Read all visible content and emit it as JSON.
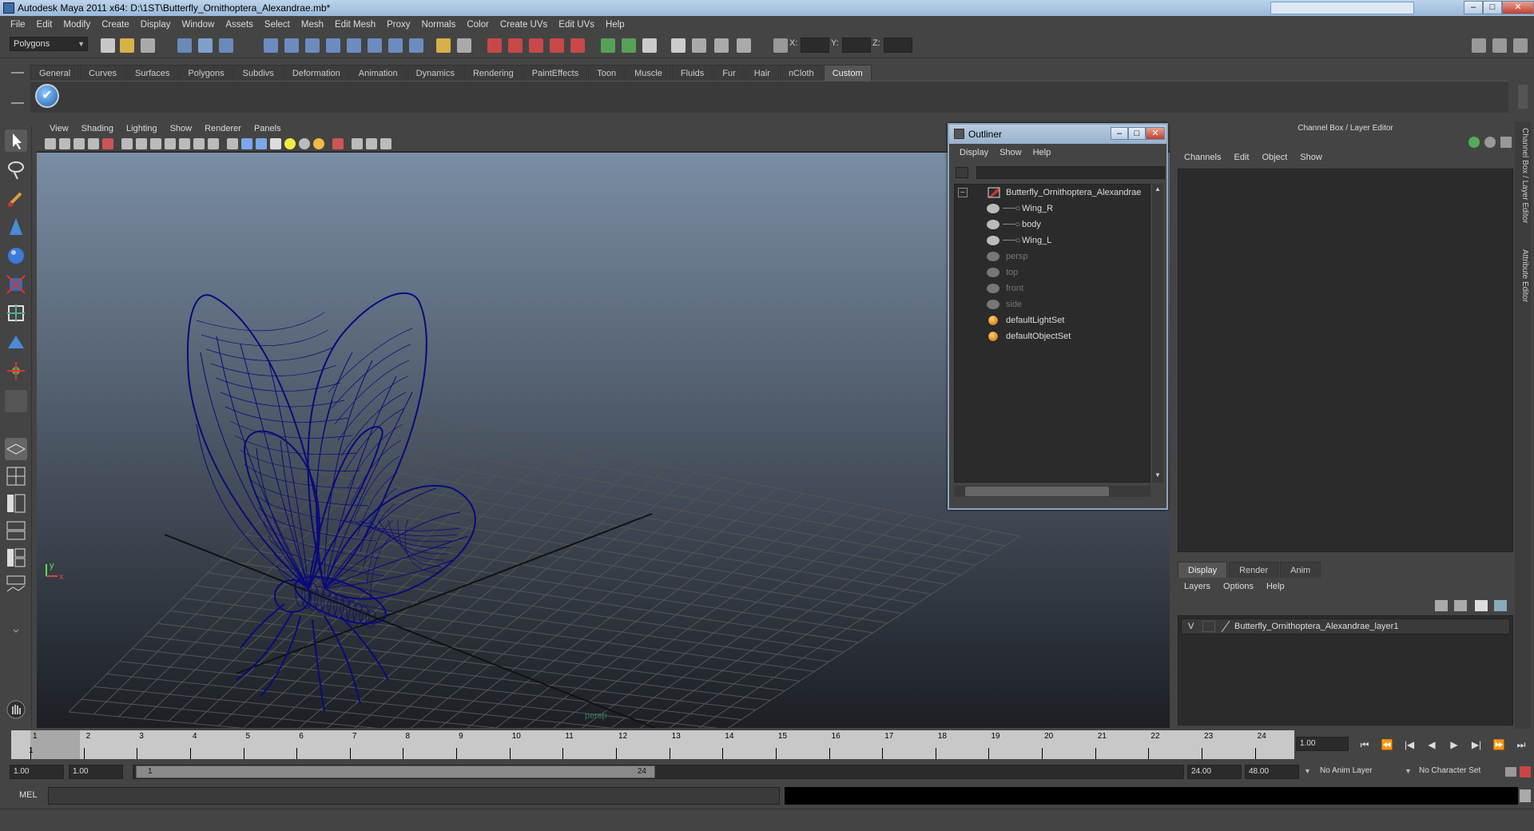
{
  "window": {
    "title": "Autodesk Maya 2011 x64: D:\\1ST\\Butterfly_Ornithoptera_Alexandrae.mb*",
    "minimize": "–",
    "maximize": "□",
    "close": "✕"
  },
  "menubar": {
    "items": [
      "File",
      "Edit",
      "Modify",
      "Create",
      "Display",
      "Window",
      "Assets",
      "Select",
      "Mesh",
      "Edit Mesh",
      "Proxy",
      "Normals",
      "Color",
      "Create UVs",
      "Edit UVs",
      "Help"
    ]
  },
  "statusline": {
    "mode": "Polygons",
    "x_label": "X:",
    "y_label": "Y:",
    "z_label": "Z:"
  },
  "shelf": {
    "tabs": [
      "General",
      "Curves",
      "Surfaces",
      "Polygons",
      "Subdivs",
      "Deformation",
      "Animation",
      "Dynamics",
      "Rendering",
      "PaintEffects",
      "Toon",
      "Muscle",
      "Fluids",
      "Fur",
      "Hair",
      "nCloth",
      "Custom"
    ],
    "active_tab": "Custom"
  },
  "viewport": {
    "menu": [
      "View",
      "Shading",
      "Lighting",
      "Show",
      "Renderer",
      "Panels"
    ],
    "camera": "persp",
    "axis_x": "x",
    "axis_y": "y"
  },
  "outliner": {
    "title": "Outliner",
    "menu": [
      "Display",
      "Show",
      "Help"
    ],
    "collapse": "−",
    "items": [
      {
        "label": "Butterfly_Ornithoptera_Alexandrae",
        "dim": false
      },
      {
        "label": "Wing_R",
        "dim": false
      },
      {
        "label": "body",
        "dim": false
      },
      {
        "label": "Wing_L",
        "dim": false
      },
      {
        "label": "persp",
        "dim": true
      },
      {
        "label": "top",
        "dim": true
      },
      {
        "label": "front",
        "dim": true
      },
      {
        "label": "side",
        "dim": true
      },
      {
        "label": "defaultLightSet",
        "dim": false
      },
      {
        "label": "defaultObjectSet",
        "dim": false
      }
    ]
  },
  "channelbox": {
    "title": "Channel Box / Layer Editor",
    "menu": [
      "Channels",
      "Edit",
      "Object",
      "Show"
    ],
    "side_tabs": [
      "Channel Box / Layer Editor",
      "Attribute Editor"
    ]
  },
  "layers": {
    "tabs": [
      "Display",
      "Render",
      "Anim"
    ],
    "active_tab": "Display",
    "menu": [
      "Layers",
      "Options",
      "Help"
    ],
    "rows": [
      {
        "visible": "V",
        "name": "Butterfly_Ornithoptera_Alexandrae_layer1"
      }
    ]
  },
  "timeline": {
    "frames": [
      "1",
      "2",
      "3",
      "4",
      "5",
      "6",
      "7",
      "8",
      "9",
      "10",
      "11",
      "12",
      "13",
      "14",
      "15",
      "16",
      "17",
      "18",
      "19",
      "20",
      "21",
      "22",
      "23",
      "24"
    ],
    "current_frame_marker": "1",
    "current_frame": "1.00",
    "playback": [
      "⏮",
      "⏪",
      "|◀",
      "◀",
      "▶",
      "▶|",
      "⏩",
      "⏭"
    ]
  },
  "range": {
    "start": "1.00",
    "anim_start": "1.00",
    "range_start": "1",
    "range_end": "24",
    "anim_end": "24.00",
    "end": "48.00",
    "anim_layer": "No Anim Layer",
    "character_set": "No Character Set"
  },
  "commandline": {
    "label": "MEL"
  },
  "colors": {
    "wireframe": "#0a0a7a",
    "viewport_top": "#7a8da4",
    "viewport_bottom": "#1c1f24",
    "ui_bg": "#444444"
  }
}
